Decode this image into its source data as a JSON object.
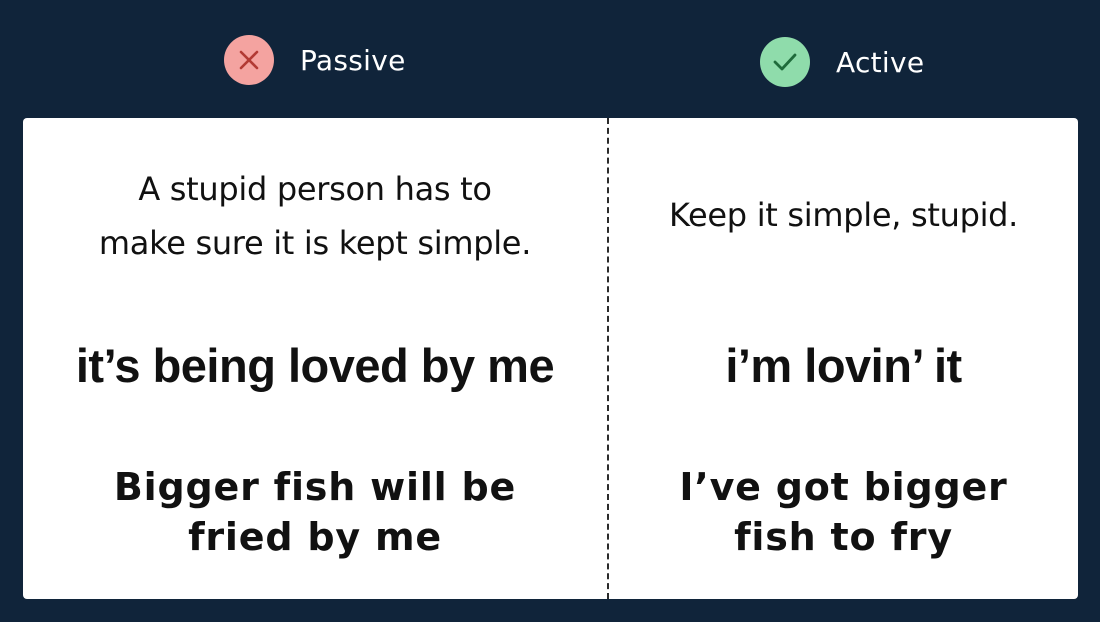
{
  "header": {
    "passive": {
      "label": "Passive",
      "icon": "x-icon",
      "badge_color": "#f4a3a0",
      "icon_color": "#b23a34"
    },
    "active": {
      "label": "Active",
      "icon": "check-icon",
      "badge_color": "#8fdcab",
      "icon_color": "#1f6b3b"
    }
  },
  "colors": {
    "background": "#10243a",
    "card": "#ffffff",
    "text": "#111111"
  },
  "comparisons": {
    "passive": [
      {
        "lines": [
          "A stupid person has to",
          "make sure it is kept simple."
        ]
      },
      {
        "lines": [
          "it’s being loved by me"
        ]
      },
      {
        "lines": [
          "Bigger fish will be",
          "fried by me"
        ]
      }
    ],
    "active": [
      {
        "lines": [
          "Keep it simple, stupid."
        ]
      },
      {
        "lines": [
          "i’m lovin’ it"
        ]
      },
      {
        "lines": [
          "I’ve got bigger",
          "fish to fry"
        ]
      }
    ]
  }
}
